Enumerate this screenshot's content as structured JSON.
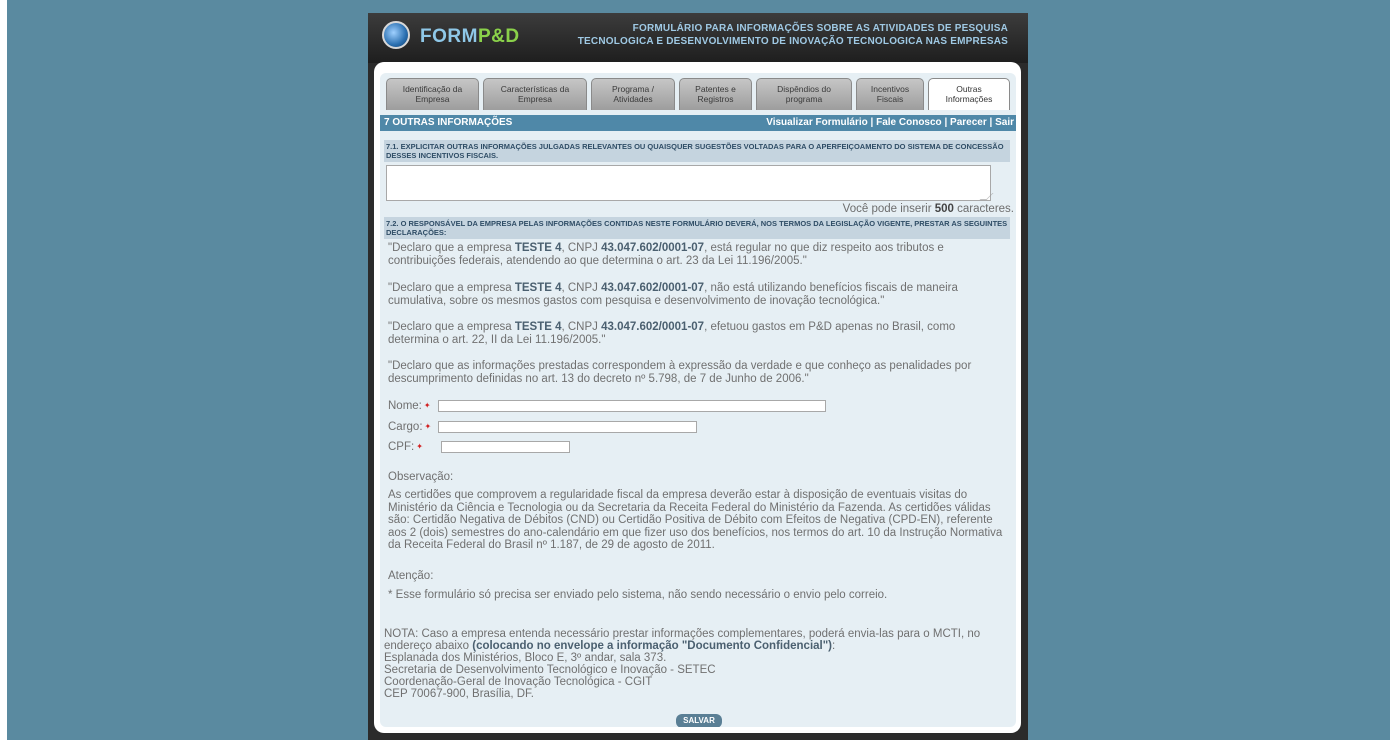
{
  "header": {
    "logo_form": "FORM",
    "logo_pd": "P&D",
    "title_line1": "FORMULÁRIO PARA INFORMAÇÕES SOBRE AS ATIVIDADES DE PESQUISA",
    "title_line2": "TECNOLOGICA E DESENVOLVIMENTO DE INOVAÇÃO TECNOLOGICA NAS EMPRESAS"
  },
  "tabs": [
    {
      "line1": "Identificação da",
      "line2": "Empresa"
    },
    {
      "line1": "Características da",
      "line2": "Empresa"
    },
    {
      "line1": "Programa /",
      "line2": "Atividades"
    },
    {
      "line1": "Patentes e",
      "line2": "Registros"
    },
    {
      "line1": "Dispêndios do",
      "line2": "programa"
    },
    {
      "line1": "Incentivos",
      "line2": "Fiscais"
    },
    {
      "line1": "Outras",
      "line2": "Informações"
    }
  ],
  "section": {
    "title": "7 OUTRAS INFORMAÇÕES",
    "link_visualizar": "Visualizar Formulário",
    "link_fale": "Fale Conosco",
    "link_parecer": "Parecer",
    "link_sair": "Sair",
    "sep": " | "
  },
  "q71": {
    "header": "7.1. EXPLICITAR OUTRAS INFORMAÇÕES JULGADAS RELEVANTES OU QUAISQUER SUGESTÕES VOLTADAS PARA O APERFEIÇOAMENTO DO SISTEMA DE CONCESSÃO DESSES INCENTIVOS FISCAIS.",
    "value": "",
    "count_prefix": "Você pode inserir ",
    "count_value": "500",
    "count_suffix": " caracteres."
  },
  "q72": {
    "header": "7.2. O RESPONSÁVEL DA EMPRESA PELAS INFORMAÇÕES CONTIDAS NESTE FORMULÁRIO DEVERÁ, NOS TERMOS DA LEGISLAÇÃO VIGENTE, PRESTAR AS SEGUINTES DECLARAÇÕES:"
  },
  "company": "TESTE 4",
  "cnpj": "43.047.602/0001-07",
  "declarations": {
    "d1_a": "\"Declaro que a empresa ",
    "d1_b": ", CNPJ ",
    "d1_c": ", está regular no que diz respeito aos tributos e contribuições federais, atendendo ao que determina o art. 23 da Lei 11.196/2005.\"",
    "d2_a": "\"Declaro que a empresa ",
    "d2_b": ", CNPJ ",
    "d2_c": ", não está utilizando benefícios fiscais de maneira cumulativa, sobre os mesmos gastos com pesquisa e desenvolvimento de inovação tecnológica.\"",
    "d3_a": "\"Declaro que a empresa ",
    "d3_b": ", CNPJ ",
    "d3_c": ", efetuou gastos em P&D apenas no Brasil, como determina o art. 22, II da Lei 11.196/2005.\"",
    "d4": "\"Declaro que as informações prestadas correspondem à expressão da verdade e que conheço as penalidades por descumprimento definidas no art. 13 do decreto nº 5.798, de 7 de Junho de 2006.\""
  },
  "form": {
    "nome_label": "Nome:",
    "cargo_label": "Cargo:",
    "cpf_label": "CPF:",
    "req_mark": "✦",
    "nome_value": "",
    "cargo_value": "",
    "cpf_value": ""
  },
  "observacao": {
    "title": "Observação:",
    "text": "As certidões que comprovem a regularidade fiscal da empresa deverão estar à disposição de eventuais visitas do Ministério da Ciência e Tecnologia ou da Secretaria da Receita Federal do Ministério da Fazenda. As certidões válidas são: Certidão Negativa de Débitos (CND) ou Certidão Positiva de Débito com Efeitos de Negativa (CPD-EN), referente aos 2 (dois) semestres do ano-calendário em que fizer uso dos benefícios, nos termos do art. 10 da Instrução Normativa da Receita Federal do Brasil nº 1.187, de 29 de agosto de 2011."
  },
  "atencao": {
    "title": "Atenção:",
    "text": "* Esse formulário só precisa ser enviado pelo sistema, não sendo necessário o envio pelo correio."
  },
  "nota": {
    "text_a": "NOTA: Caso a empresa entenda necessário prestar informações complementares, poderá envia-las para o MCTI, no endereço abaixo ",
    "text_bold": "(colocando no envelope a informação \"Documento Confidencial\")",
    "text_colon": ":",
    "addr1": "Esplanada dos Ministérios, Bloco E, 3º andar, sala 373.",
    "addr2": "Secretaria de Desenvolvimento Tecnológico e Inovação - SETEC",
    "addr3": "Coordenação-Geral de Inovação Tecnológica - CGIT",
    "addr4": "CEP 70067-900, Brasília, DF."
  },
  "save_label": "SALVAR"
}
